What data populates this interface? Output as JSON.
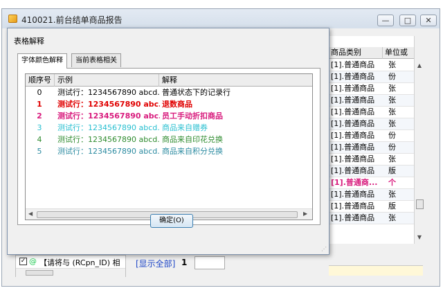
{
  "window": {
    "title": "410021.前台结单商品报告",
    "min_label": "—",
    "max_label": "□",
    "close_label": "✕"
  },
  "background_grid": {
    "headers": [
      "商品类别",
      "单位或"
    ],
    "rows": [
      {
        "category": "[1].普通商品",
        "unit": "张"
      },
      {
        "category": "[1].普通商品",
        "unit": "份"
      },
      {
        "category": "[1].普通商品",
        "unit": "张"
      },
      {
        "category": "[1].普通商品",
        "unit": "张"
      },
      {
        "category": "[1].普通商品",
        "unit": "张"
      },
      {
        "category": "[1].普通商品",
        "unit": "张"
      },
      {
        "category": "[1].普通商品",
        "unit": "份"
      },
      {
        "category": "[1].普通商品",
        "unit": "份"
      },
      {
        "category": "[1].普通商品",
        "unit": "张"
      },
      {
        "category": "[1].普通商品",
        "unit": "版"
      },
      {
        "category": "[1].普通商...",
        "unit": "个",
        "style": "pink"
      },
      {
        "category": "[1].普通商品",
        "unit": "张"
      },
      {
        "category": "[1].普通商品",
        "unit": "版"
      },
      {
        "category": "[1].普通商品",
        "unit": "张"
      }
    ]
  },
  "bottom": {
    "checkbox_mark": "✓",
    "rule_text": "【请将与 (RCpn_ID) 相",
    "show_all": "[显示全部]",
    "count": "1"
  },
  "dialog": {
    "title": "表格解释",
    "tabs": [
      "字体颜色解释",
      "当前表格相关"
    ],
    "list_headers": [
      "顺序号",
      "示例",
      "解释"
    ],
    "rows": [
      {
        "no": "0",
        "example": "测试行：1234567890 abcd...",
        "desc": "普通状态下的记录行",
        "color": "#000000",
        "bold": false
      },
      {
        "no": "1",
        "example": "测试行：1234567890 abc...",
        "desc": "退数商品",
        "color": "#e00000",
        "bold": true
      },
      {
        "no": "2",
        "example": "测试行：1234567890 abc...",
        "desc": "员工手动折扣商品",
        "color": "#d81b7d",
        "bold": true
      },
      {
        "no": "3",
        "example": "测试行：1234567890 abcd...",
        "desc": "商品来自赠券",
        "color": "#27bfd0",
        "bold": false
      },
      {
        "no": "4",
        "example": "测试行：1234567890 abcd...",
        "desc": "商品来自印花兑换",
        "color": "#2e8b2e",
        "bold": false
      },
      {
        "no": "5",
        "example": "测试行：1234567890 abcd...",
        "desc": "商品来自积分兑换",
        "color": "#2a8aa0",
        "bold": false
      }
    ],
    "ok_label": "确定(O)"
  }
}
